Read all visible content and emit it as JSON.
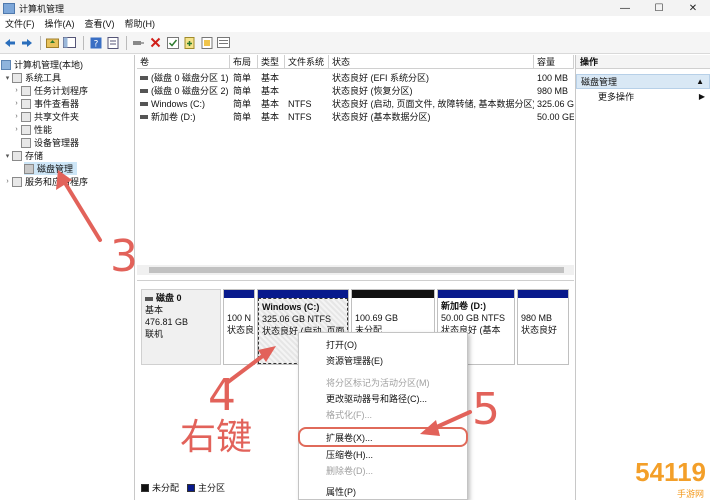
{
  "window": {
    "title": "计算机管理",
    "controls": [
      "—",
      "☐",
      "✕"
    ]
  },
  "menubar": {
    "items": [
      "文件(F)",
      "操作(A)",
      "查看(V)",
      "帮助(H)"
    ]
  },
  "toolbar": {
    "buttons": [
      "back-icon",
      "forward-icon",
      "up-folder-icon",
      "console-tree-icon",
      "help-icon",
      "properties-icon",
      "connect-icon",
      "delete-icon",
      "check-icon",
      "new-icon",
      "export-icon",
      "view-icon"
    ]
  },
  "tree": {
    "root": "计算机管理(本地)",
    "system_tools": "系统工具",
    "task_scheduler": "任务计划程序",
    "event_viewer": "事件查看器",
    "shared_folders": "共享文件夹",
    "performance": "性能",
    "device_manager": "设备管理器",
    "storage": "存储",
    "disk_management": "磁盘管理",
    "services": "服务和应用程序"
  },
  "volume_list": {
    "headers": [
      "卷",
      "布局",
      "类型",
      "文件系统",
      "状态",
      "容量"
    ],
    "rows": [
      [
        "(磁盘 0 磁盘分区 1)",
        "简单",
        "基本",
        "",
        "状态良好 (EFI 系统分区)",
        "100 MB"
      ],
      [
        "(磁盘 0 磁盘分区 2)",
        "简单",
        "基本",
        "",
        "状态良好 (恢复分区)",
        "980 MB"
      ],
      [
        "Windows (C:)",
        "简单",
        "基本",
        "NTFS",
        "状态良好 (启动, 页面文件, 故障转储, 基本数据分区)",
        "325.06 G"
      ],
      [
        "新加卷 (D:)",
        "简单",
        "基本",
        "NTFS",
        "状态良好 (基本数据分区)",
        "50.00 GE"
      ]
    ]
  },
  "disk_map": {
    "disk_name": "磁盘 0",
    "disk_type": "基本",
    "disk_size": "476.81 GB",
    "disk_status": "联机",
    "partitions": [
      {
        "line1": "",
        "line2": "100 N",
        "line3": "状态良"
      },
      {
        "line1": "Windows  (C:)",
        "line2": "325.06 GB NTFS",
        "line3": "状态良好 (启动, 页面"
      },
      {
        "line1": "",
        "line2": "100.69 GB",
        "line3": "未分配"
      },
      {
        "line1": "新加卷  (D:)",
        "line2": "50.00 GB NTFS",
        "line3": "状态良好 (基本"
      },
      {
        "line1": "",
        "line2": "980 MB",
        "line3": "状态良好"
      }
    ],
    "legend": [
      {
        "label": "未分配",
        "color": "#111111"
      },
      {
        "label": "主分区",
        "color": "#081a8c"
      }
    ]
  },
  "actions": {
    "title": "操作",
    "group": "磁盘管理",
    "more": "更多操作"
  },
  "context_menu": {
    "items": [
      {
        "label": "打开(O)",
        "enabled": true
      },
      {
        "label": "资源管理器(E)",
        "enabled": true
      },
      {
        "label": "将分区标记为活动分区(M)",
        "enabled": false
      },
      {
        "label": "更改驱动器号和路径(C)...",
        "enabled": true
      },
      {
        "label": "格式化(F)...",
        "enabled": false
      },
      {
        "label": "扩展卷(X)...",
        "enabled": true
      },
      {
        "label": "压缩卷(H)...",
        "enabled": true
      },
      {
        "label": "删除卷(D)...",
        "enabled": false
      },
      {
        "label": "属性(P)",
        "enabled": true
      }
    ]
  },
  "annotations": {
    "step3": "3",
    "step4": "4",
    "right_click": "右键",
    "step5": "5",
    "color": "#e2625a"
  },
  "watermark": {
    "text": "54119",
    "sub": "手游网"
  }
}
